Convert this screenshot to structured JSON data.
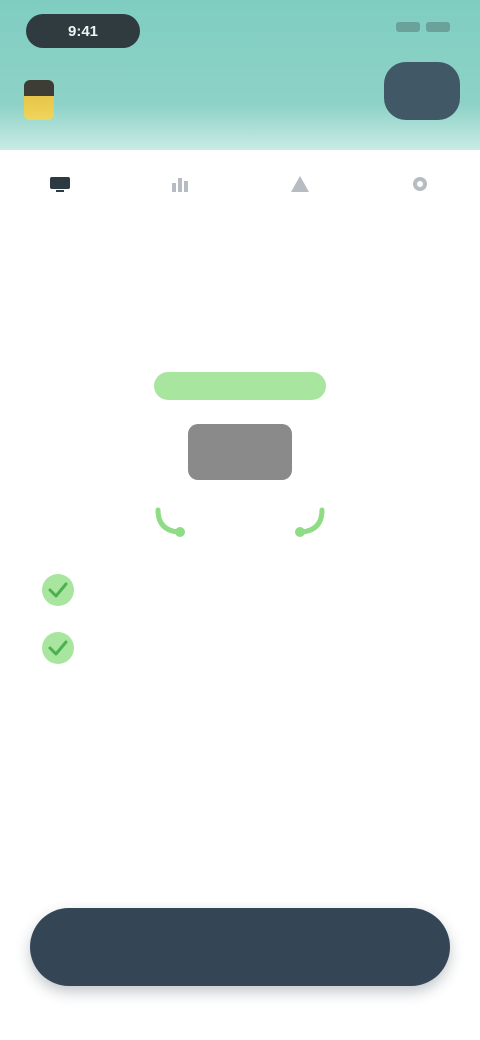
{
  "status_bar": {
    "time": "9:41"
  },
  "header": {
    "greeting": "",
    "greeting_sub": "",
    "action_label": ""
  },
  "nav": {
    "items": [
      {
        "label": "",
        "icon": "device-icon"
      },
      {
        "label": "",
        "icon": "chart-icon"
      },
      {
        "label": "",
        "icon": "alert-icon"
      },
      {
        "label": "",
        "icon": "settings-icon"
      }
    ]
  },
  "main": {
    "title": "",
    "status": "",
    "device_label": "",
    "checklist": [
      {
        "text": ""
      },
      {
        "text": ""
      }
    ]
  },
  "footer": {
    "button_label": ""
  },
  "colors": {
    "header": "#7fcdc1",
    "accent_green": "#a8e6a0",
    "button": "#344556"
  }
}
